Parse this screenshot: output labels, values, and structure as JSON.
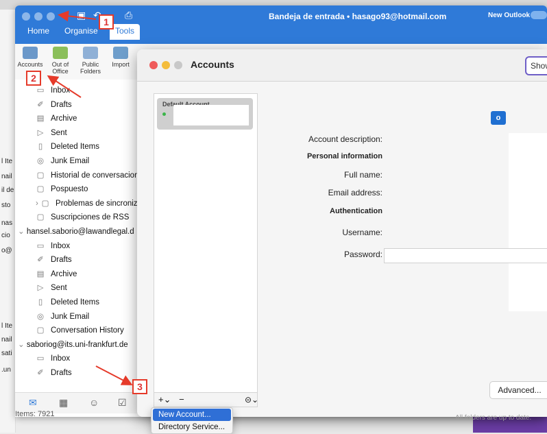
{
  "background": {
    "left_fragments": [
      "l Ite",
      "nail",
      "il de",
      "sto",
      "nas",
      "cio",
      "o@",
      "l Ite",
      "nail",
      "sati",
      ".un"
    ]
  },
  "window": {
    "title": "Bandeja de entrada • hasago93@hotmail.com",
    "new_outlook_label": "New Outlook"
  },
  "tabs": [
    "Home",
    "Organise",
    "Tools"
  ],
  "ribbon": {
    "buttons": [
      {
        "label": "Accounts",
        "icon": "accounts-icon"
      },
      {
        "label": "Out of Office",
        "icon": "out-of-office-icon"
      },
      {
        "label": "Public Folders",
        "icon": "public-folders-icon"
      },
      {
        "label": "Import",
        "icon": "import-icon"
      }
    ]
  },
  "folders": {
    "account1_items": [
      {
        "label": "Inbox",
        "icon": "inbox-icon"
      },
      {
        "label": "Drafts",
        "icon": "drafts-icon"
      },
      {
        "label": "Archive",
        "icon": "archive-icon"
      },
      {
        "label": "Sent",
        "icon": "sent-icon"
      },
      {
        "label": "Deleted Items",
        "icon": "trash-icon"
      },
      {
        "label": "Junk Email",
        "icon": "junk-icon"
      },
      {
        "label": "Historial de conversaciones",
        "icon": "folder-icon"
      },
      {
        "label": "Pospuesto",
        "icon": "folder-icon"
      },
      {
        "label": "Problemas de sincronización",
        "icon": "folder-icon"
      },
      {
        "label": "Suscripciones de RSS",
        "icon": "folder-icon"
      }
    ],
    "account2": "hansel.saborio@lawandlegal.d",
    "account2_items": [
      {
        "label": "Inbox",
        "icon": "inbox-icon"
      },
      {
        "label": "Drafts",
        "icon": "drafts-icon"
      },
      {
        "label": "Archive",
        "icon": "archive-icon"
      },
      {
        "label": "Sent",
        "icon": "sent-icon"
      },
      {
        "label": "Deleted Items",
        "icon": "trash-icon"
      },
      {
        "label": "Junk Email",
        "icon": "junk-icon"
      },
      {
        "label": "Conversation History",
        "icon": "folder-icon"
      }
    ],
    "account3": "saboriog@its.uni-frankfurt.de",
    "account3_items": [
      {
        "label": "Inbox",
        "icon": "inbox-icon"
      },
      {
        "label": "Drafts",
        "icon": "drafts-icon"
      }
    ],
    "items_count": "Items: 7921"
  },
  "dialog": {
    "title": "Accounts",
    "show_label": "Show",
    "default_account_label": "Default Account",
    "fields": {
      "account_description": "Account description:",
      "personal_information": "Personal information",
      "full_name": "Full name:",
      "email_address": "Email address:",
      "authentication": "Authentication",
      "username": "Username:",
      "password": "Password:"
    },
    "advanced_label": "Advanced...",
    "add_menu": [
      "New Account...",
      "Directory Service..."
    ],
    "status": "All folders are up to date."
  },
  "annotations": [
    "1",
    "2",
    "3"
  ],
  "colors": {
    "accent": "#2f7ad8",
    "annotation": "#e53a2a"
  }
}
